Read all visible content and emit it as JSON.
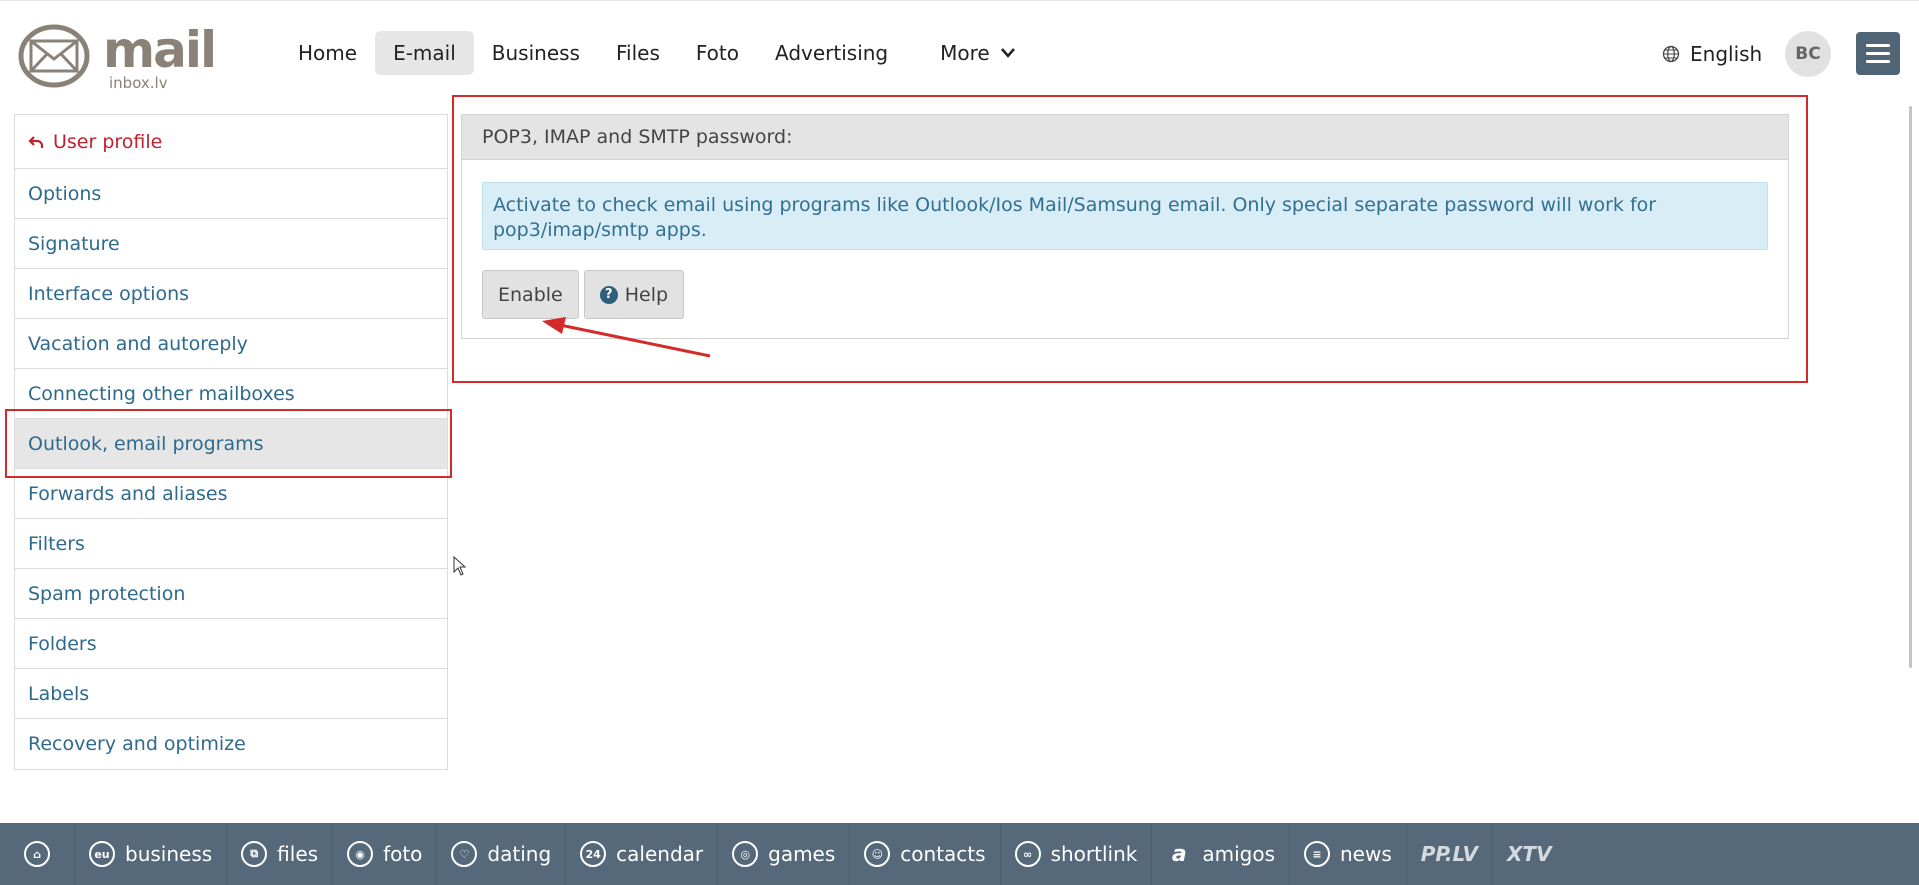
{
  "logo": {
    "word": "mail",
    "sub": "inbox.lv"
  },
  "nav": {
    "items": [
      "Home",
      "E-mail",
      "Business",
      "Files",
      "Foto",
      "Advertising"
    ],
    "more": "More",
    "active_index": 1
  },
  "header": {
    "language": "English",
    "avatar_initials": "BC"
  },
  "sidebar": {
    "back_label": "User profile",
    "items": [
      "Options",
      "Signature",
      "Interface options",
      "Vacation and autoreply",
      "Connecting other mailboxes",
      "Outlook, email programs",
      "Forwards and aliases",
      "Filters",
      "Spam protection",
      "Folders",
      "Labels",
      "Recovery and optimize"
    ],
    "selected_index": 5
  },
  "panel": {
    "title": "POP3, IMAP and SMTP password:",
    "info": "Activate to check email using programs like Outlook/Ios Mail/Samsung email. Only special separate password will work for pop3/imap/smtp apps.",
    "enable_label": "Enable",
    "help_label": "Help"
  },
  "footer": {
    "items": [
      "business",
      "files",
      "foto",
      "dating",
      "calendar",
      "games",
      "contacts",
      "shortlink",
      "amigos",
      "news"
    ],
    "brands": [
      "PP.LV",
      "XTV"
    ]
  },
  "colors": {
    "link": "#2d6a8d",
    "back_link": "#c0212f",
    "footer_bg": "#55697a",
    "info_bg": "#d9edf7",
    "annotation": "#d42a2a"
  }
}
